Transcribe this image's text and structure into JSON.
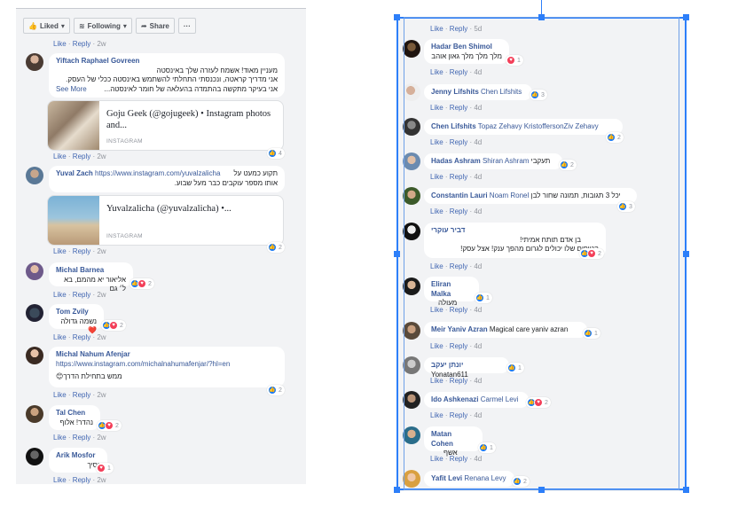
{
  "left_panel": {
    "liked_label": "Liked",
    "following_label": "Following",
    "share_label": "Share",
    "more_label": "···",
    "top_meta": {
      "like": "Like",
      "reply": "Reply",
      "time": "2w"
    },
    "comments": [
      {
        "name": "Yiftach Raphael Govreen",
        "lines": [
          "מעניין מאוד! אשמח לעזרה שלך באינסטה",
          "אני מדריך קראטה, ונכנסתי התחלתי להשתמש באינסטה ככלי של העסק.",
          "אני בעיקר מתקשה בהתמדה בהעלאה של חומר לאינסטה..."
        ],
        "see_more": "See More",
        "card": {
          "title": "Goju Geek (@gojugeek) • Instagram photos and...",
          "source": "INSTAGRAM"
        },
        "reaction_count": "4",
        "meta": {
          "like": "Like",
          "reply": "Reply",
          "time": "2w"
        }
      },
      {
        "name": "Yuval Zach",
        "link": "https://www.instagram.com/yuvalzalicha",
        "lines": [
          "תקוע כמעט על",
          "אותו מספר עוקבים כבר מעל שבוע."
        ],
        "card": {
          "title": "Yuvalzalicha (@yuvalzalicha) •...",
          "source": "INSTAGRAM"
        },
        "reaction_count": "2",
        "meta": {
          "like": "Like",
          "reply": "Reply",
          "time": "2w"
        }
      },
      {
        "name": "Michal Barnea",
        "text": "אליאור יא מהמם, בא ל׳ גם",
        "reaction_count": "2",
        "meta": {
          "like": "Like",
          "reply": "Reply",
          "time": "2w"
        }
      },
      {
        "name": "Tom Zvily",
        "text": "נשמה גדולה",
        "heart": "❤️",
        "reaction_count": "2",
        "meta": {
          "like": "Like",
          "reply": "Reply",
          "time": "2w"
        }
      },
      {
        "name": "Michal Nahum Afenjar",
        "link": "https://www.instagram.com/michalnahumafenjar/?hl=en",
        "text": "ממש בתחילת הדרך",
        "emoji": "😊",
        "reaction_count": "2",
        "meta": {
          "like": "Like",
          "reply": "Reply",
          "time": "2w"
        }
      },
      {
        "name": "Tal Chen",
        "text": "נהדר! אלוף",
        "reaction_count": "2",
        "meta": {
          "like": "Like",
          "reply": "Reply",
          "time": "2w"
        }
      },
      {
        "name": "Arik Mosfor",
        "text": "נסיך",
        "reaction_count": "1",
        "meta": {
          "like": "Like",
          "reply": "Reply",
          "time": "2w"
        }
      }
    ]
  },
  "right_panel": {
    "top_meta": {
      "like": "Like",
      "reply": "Reply",
      "time": "5d"
    },
    "comments": [
      {
        "name": "Hadar Ben Shimol",
        "text": "מלך מלך מלך גאון אוהב",
        "reaction_count": "1",
        "meta": {
          "like": "Like",
          "reply": "Reply",
          "time": "4d"
        }
      },
      {
        "name": "Jenny Lifshits",
        "tag": "Chen Lifshits",
        "reaction_count": "3",
        "meta": {
          "like": "Like",
          "reply": "Reply",
          "time": "4d"
        }
      },
      {
        "name": "Chen Lifshits",
        "tag": "Topaz Zehavy KristoffersonZiv Zehavy",
        "reaction_count": "2",
        "meta": {
          "like": "Like",
          "reply": "Reply",
          "time": "4d"
        }
      },
      {
        "name": "Hadas Ashram",
        "tag": "Shiran Ashram",
        "text": "תעקבי",
        "reaction_count": "2",
        "meta": {
          "like": "Like",
          "reply": "Reply",
          "time": "4d"
        }
      },
      {
        "name": "Constantin Lauri",
        "tag": "Noam Ronel",
        "text": "יכל 3 תגובות, תמונה שחור לבן",
        "reaction_count": "3",
        "meta": {
          "like": "Like",
          "reply": "Reply",
          "time": "4d"
        }
      },
      {
        "name": "דביר עוקרי",
        "lines": [
          "בן אדם תותח אמיתי!",
          "הטיפים שלו יכולים לגרום מהפך ענק! אצל עסק!"
        ],
        "reaction_count": "2",
        "meta": {
          "like": "Like",
          "reply": "Reply",
          "time": "4d"
        }
      },
      {
        "name": "Eliran Malka",
        "text": "מעולה",
        "reaction_count": "1",
        "meta": {
          "like": "Like",
          "reply": "Reply",
          "time": "4d"
        }
      },
      {
        "name": "Meir Yaniv Azran",
        "tag": "Magical care yaniv azran",
        "reaction_count": "1",
        "meta": {
          "like": "Like",
          "reply": "Reply",
          "time": "4d"
        }
      },
      {
        "name": "יונתן יעקב",
        "tag": "Yonatan611",
        "reaction_count": "1",
        "meta": {
          "like": "Like",
          "reply": "Reply",
          "time": "4d"
        }
      },
      {
        "name": "Ido Ashkenazi",
        "tag": "Carmel Levi",
        "reaction_count": "2",
        "meta": {
          "like": "Like",
          "reply": "Reply",
          "time": "4d"
        }
      },
      {
        "name": "Matan Cohen",
        "text": "אשף",
        "reaction_count": "1",
        "meta": {
          "like": "Like",
          "reply": "Reply",
          "time": "4d"
        }
      },
      {
        "name": "Yafit Levi",
        "tag": "Renana Levy",
        "reaction_count": "2"
      }
    ]
  },
  "colors": {
    "panel_bg": "#f2f3f5",
    "name_blue": "#385898",
    "like_blue": "#1877f2",
    "love_red": "#f33e58",
    "selection_blue": "#2d7ff9"
  }
}
